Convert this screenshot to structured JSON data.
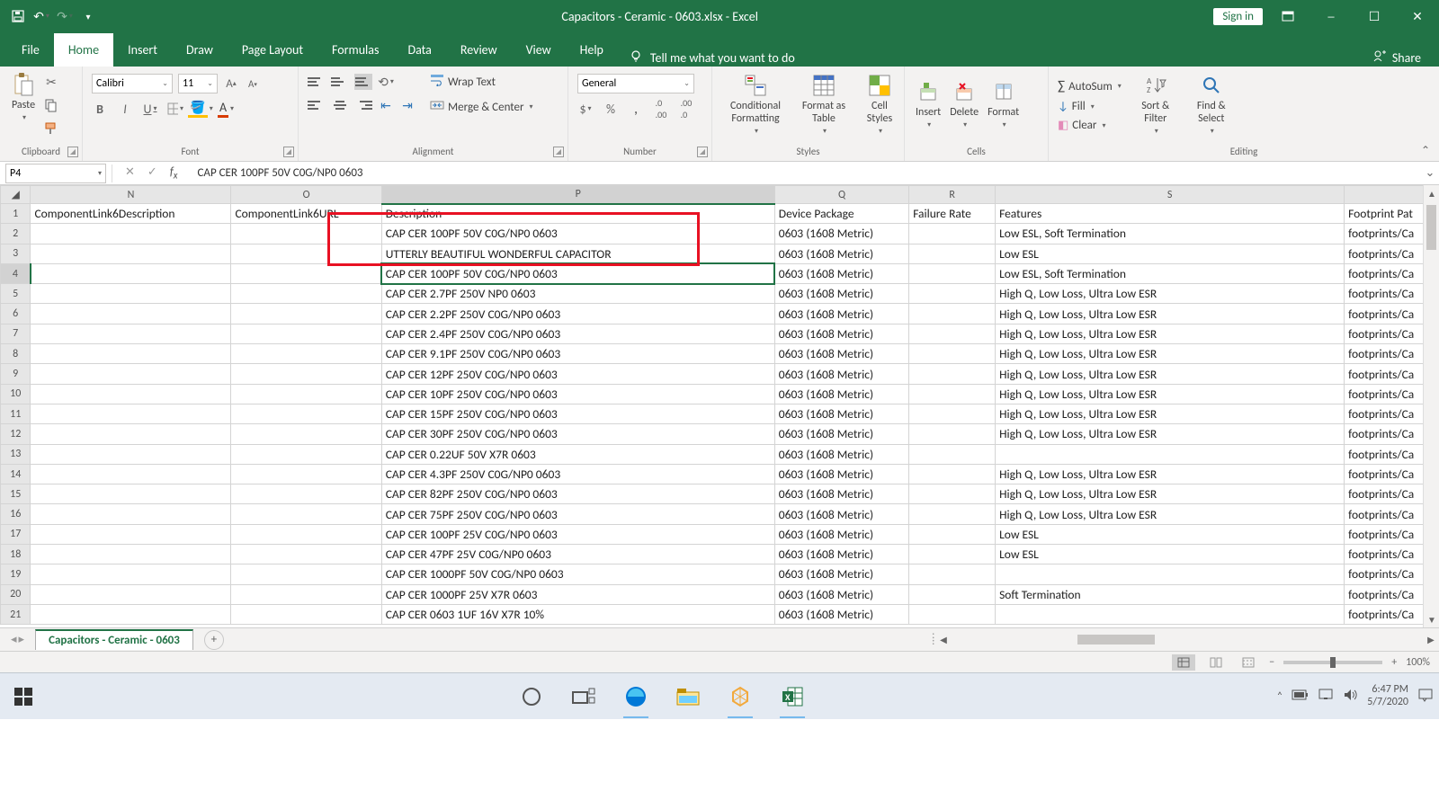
{
  "title": "Capacitors - Ceramic - 0603.xlsx - Excel",
  "signin": "Sign in",
  "tabs": [
    "File",
    "Home",
    "Insert",
    "Draw",
    "Page Layout",
    "Formulas",
    "Data",
    "Review",
    "View",
    "Help"
  ],
  "tellme": "Tell me what you want to do",
  "share": "Share",
  "ribbon": {
    "clipboard": {
      "paste": "Paste",
      "label": "Clipboard"
    },
    "font": {
      "name": "Calibri",
      "size": "11",
      "label": "Font"
    },
    "alignment": {
      "wrap": "Wrap Text",
      "merge": "Merge & Center",
      "label": "Alignment"
    },
    "number": {
      "format": "General",
      "label": "Number"
    },
    "styles": {
      "cond": "Conditional Formatting",
      "fmt": "Format as Table",
      "cell": "Cell Styles",
      "label": "Styles"
    },
    "cells": {
      "insert": "Insert",
      "delete": "Delete",
      "format": "Format",
      "label": "Cells"
    },
    "editing": {
      "autosum": "AutoSum",
      "fill": "Fill",
      "clear": "Clear",
      "sort": "Sort & Filter",
      "find": "Find & Select",
      "label": "Editing"
    }
  },
  "namebox": "P4",
  "formula": "CAP CER 100PF 50V C0G/NP0 0603",
  "columns": [
    "N",
    "O",
    "P",
    "Q",
    "R",
    "S",
    ""
  ],
  "headers": {
    "n": "ComponentLink6Description",
    "o": "ComponentLink6URL",
    "p": "Description",
    "q": "Device Package",
    "r": "Failure Rate",
    "s": "Features",
    "t": "Footprint Pat"
  },
  "rows": [
    {
      "r": 2,
      "p": "CAP CER 100PF 50V C0G/NP0 0603",
      "q": "0603 (1608 Metric)",
      "s": "Low ESL, Soft Termination",
      "t": "footprints/Ca"
    },
    {
      "r": 3,
      "p": "UTTERLY BEAUTIFUL WONDERFUL CAPACITOR",
      "q": "0603 (1608 Metric)",
      "s": "Low ESL",
      "t": "footprints/Ca"
    },
    {
      "r": 4,
      "p": "CAP CER 100PF 50V C0G/NP0 0603",
      "q": "0603 (1608 Metric)",
      "s": "Low ESL, Soft Termination",
      "t": "footprints/Ca"
    },
    {
      "r": 5,
      "p": "CAP CER 2.7PF 250V NP0 0603",
      "q": "0603 (1608 Metric)",
      "s": "High Q, Low Loss, Ultra Low ESR",
      "t": "footprints/Ca"
    },
    {
      "r": 6,
      "p": "CAP CER 2.2PF 250V C0G/NP0 0603",
      "q": "0603 (1608 Metric)",
      "s": "High Q, Low Loss, Ultra Low ESR",
      "t": "footprints/Ca"
    },
    {
      "r": 7,
      "p": "CAP CER 2.4PF 250V C0G/NP0 0603",
      "q": "0603 (1608 Metric)",
      "s": "High Q, Low Loss, Ultra Low ESR",
      "t": "footprints/Ca"
    },
    {
      "r": 8,
      "p": "CAP CER 9.1PF 250V C0G/NP0 0603",
      "q": "0603 (1608 Metric)",
      "s": "High Q, Low Loss, Ultra Low ESR",
      "t": "footprints/Ca"
    },
    {
      "r": 9,
      "p": "CAP CER 12PF 250V C0G/NP0 0603",
      "q": "0603 (1608 Metric)",
      "s": "High Q, Low Loss, Ultra Low ESR",
      "t": "footprints/Ca"
    },
    {
      "r": 10,
      "p": "CAP CER 10PF 250V C0G/NP0 0603",
      "q": "0603 (1608 Metric)",
      "s": "High Q, Low Loss, Ultra Low ESR",
      "t": "footprints/Ca"
    },
    {
      "r": 11,
      "p": "CAP CER 15PF 250V C0G/NP0 0603",
      "q": "0603 (1608 Metric)",
      "s": "High Q, Low Loss, Ultra Low ESR",
      "t": "footprints/Ca"
    },
    {
      "r": 12,
      "p": "CAP CER 30PF 250V C0G/NP0 0603",
      "q": "0603 (1608 Metric)",
      "s": "High Q, Low Loss, Ultra Low ESR",
      "t": "footprints/Ca"
    },
    {
      "r": 13,
      "p": "CAP CER 0.22UF 50V X7R 0603",
      "q": "0603 (1608 Metric)",
      "s": "",
      "t": "footprints/Ca"
    },
    {
      "r": 14,
      "p": "CAP CER 4.3PF 250V C0G/NP0 0603",
      "q": "0603 (1608 Metric)",
      "s": "High Q, Low Loss, Ultra Low ESR",
      "t": "footprints/Ca"
    },
    {
      "r": 15,
      "p": "CAP CER 82PF 250V C0G/NP0 0603",
      "q": "0603 (1608 Metric)",
      "s": "High Q, Low Loss, Ultra Low ESR",
      "t": "footprints/Ca"
    },
    {
      "r": 16,
      "p": "CAP CER 75PF 250V C0G/NP0 0603",
      "q": "0603 (1608 Metric)",
      "s": "High Q, Low Loss, Ultra Low ESR",
      "t": "footprints/Ca"
    },
    {
      "r": 17,
      "p": "CAP CER 100PF 25V C0G/NP0 0603",
      "q": "0603 (1608 Metric)",
      "s": "Low ESL",
      "t": "footprints/Ca"
    },
    {
      "r": 18,
      "p": "CAP CER 47PF 25V C0G/NP0 0603",
      "q": "0603 (1608 Metric)",
      "s": "Low ESL",
      "t": "footprints/Ca"
    },
    {
      "r": 19,
      "p": "CAP CER 1000PF 50V C0G/NP0 0603",
      "q": "0603 (1608 Metric)",
      "s": "",
      "t": "footprints/Ca"
    },
    {
      "r": 20,
      "p": "CAP CER 1000PF 25V X7R 0603",
      "q": "0603 (1608 Metric)",
      "s": "Soft Termination",
      "t": "footprints/Ca"
    },
    {
      "r": 21,
      "p": "CAP CER 0603 1UF 16V X7R 10%",
      "q": "0603 (1608 Metric)",
      "s": "",
      "t": "footprints/Ca"
    }
  ],
  "sheet": "Capacitors - Ceramic - 0603",
  "zoom": "100%",
  "clock": {
    "time": "6:47 PM",
    "date": "5/7/2020"
  }
}
